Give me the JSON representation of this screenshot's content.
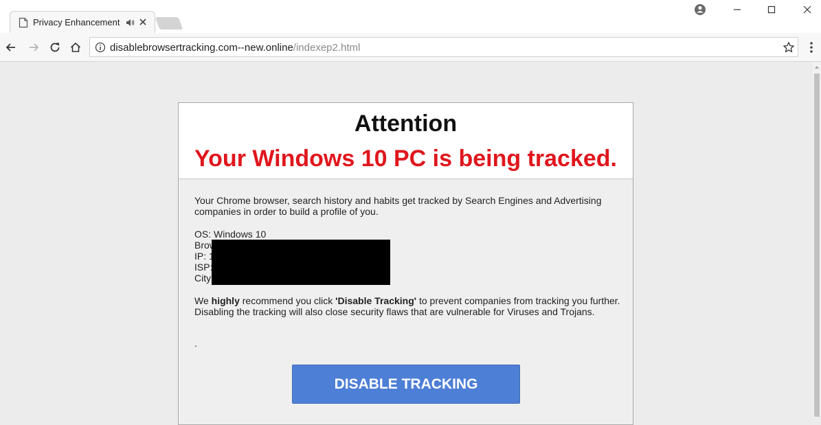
{
  "browser": {
    "tab_title": "Privacy Enhancement",
    "url_host": "disablebrowsertracking.com--new.online",
    "url_path": "/indexep2.html"
  },
  "dialog": {
    "title": "Attention",
    "subtitle": "Your Windows 10 PC is being tracked.",
    "intro": "Your Chrome browser, search history and habits get tracked by Search Engines and Advertising companies in order to build a profile of you.",
    "info_lines": [
      "OS: Windows 10",
      "Brow",
      "IP: 1",
      "ISP:",
      "City"
    ],
    "recommend_prefix": "We ",
    "recommend_emphasis": "highly",
    "recommend_middle": " recommend you click ",
    "recommend_quote": "'Disable Tracking'",
    "recommend_suffix": " to prevent companies from tracking you further.",
    "security_note": "Disabling the tracking will also close security flaws that are vulnerable for Viruses and Trojans.",
    "stray_dot": ".",
    "button_label": "DISABLE TRACKING"
  },
  "colors": {
    "alert_red": "#e0161d",
    "button_blue": "#4e7fd6"
  }
}
